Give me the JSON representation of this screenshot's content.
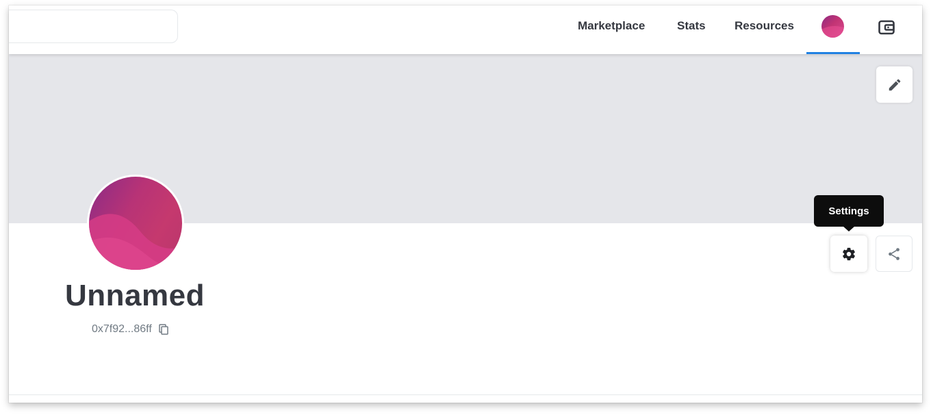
{
  "header": {
    "search": {
      "placeholder": ""
    },
    "nav": {
      "marketplace": "Marketplace",
      "stats": "Stats",
      "resources": "Resources"
    },
    "profile_icon": "avatar-gradient",
    "wallet_icon": "wallet-icon",
    "active_underline_color": "#2081e2"
  },
  "banner": {
    "color": "#e5e6ea",
    "edit_icon": "pencil-icon"
  },
  "profile": {
    "name": "Unnamed",
    "address": "0x7f92...86ff",
    "copy_icon": "copy-icon",
    "avatar_colors": [
      "#8a2b86",
      "#c23474",
      "#d94a8f"
    ]
  },
  "actions": {
    "settings_icon": "gear-icon",
    "share_icon": "share-icon",
    "tooltip": "Settings"
  }
}
